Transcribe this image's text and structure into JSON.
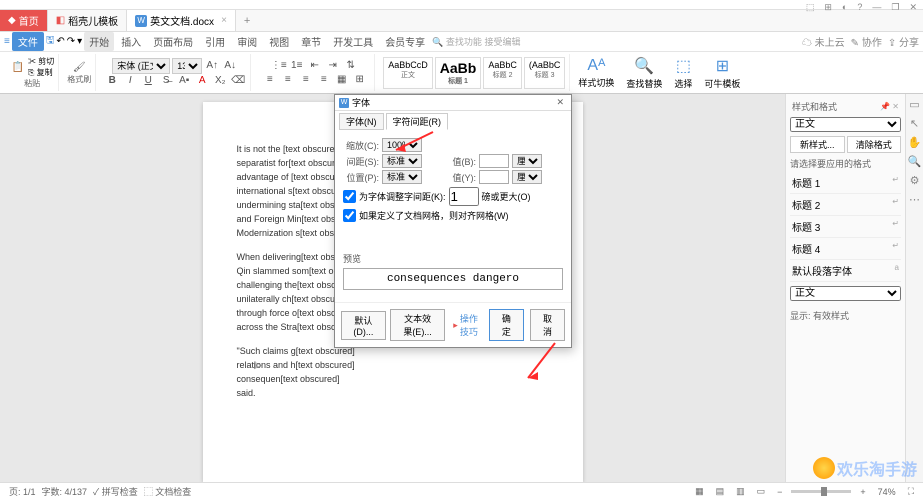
{
  "tabs": {
    "home": "首页",
    "tpl": "稻壳儿模板",
    "doc": "英文文档.docx"
  },
  "win_ctrls": [
    "⬚",
    "⊞",
    "◐",
    "?",
    "—",
    "❐",
    "✕"
  ],
  "menu": {
    "file": "文件",
    "items": [
      "开始",
      "插入",
      "页面布局",
      "引用",
      "审阅",
      "视图",
      "章节",
      "开发工具",
      "会员专享"
    ],
    "search_placeholder": "查找功能",
    "search_tpl": "接受编辑",
    "right": [
      "未上云",
      "协作",
      "分享"
    ]
  },
  "ribbon": {
    "paste": "粘贴",
    "copy": "复制",
    "cut": "剪切",
    "format_painter": "格式刷",
    "font": "宋体 (正文)",
    "size": "13.5",
    "styles": [
      {
        "preview": "AaBbCcD",
        "name": "正文"
      },
      {
        "preview": "AaBb",
        "name": "标题 1"
      },
      {
        "preview": "AaBbC",
        "name": "标题 2"
      },
      {
        "preview": "(AaBbC",
        "name": "标题 3"
      }
    ],
    "style_switch": "样式切换",
    "find_replace": "查找替换",
    "select": "选择",
    "cowork": "可牛模板"
  },
  "document": {
    "p1": "It is not the [text obscured]\nseparatist for[text obscured]\nadvantage of [text obscured]\ninternational s[text obscured]\nundermining sta[text obscured]\nand Foreign Min[text obscured]\nModernization s[text obscured]",
    "p2": "When delivering[text obscured]\nQin slammed som[text obscured]\nchallenging the[text obscured]\nunilaterally ch[text obscured]\nthrough force o[text obscured]\nacross the Stra[text obscured]",
    "p3": "\"Such claims g[text obscured]\nrelations and h[text obscured]\nconsequen[text obscured]\nsaid."
  },
  "dialog": {
    "title": "字体",
    "tabs": [
      "字体(N)",
      "字符间距(R)"
    ],
    "scale_label": "缩放(C):",
    "scale_val": "100%",
    "spacing_label": "间距(S):",
    "spacing_val": "标准",
    "spacing_by": "值(B):",
    "unit": "厘米",
    "position_label": "位置(P):",
    "position_val": "标准",
    "position_by": "值(Y):",
    "kerning": "为字体调整字间距(K):",
    "kerning_val": "1",
    "kerning_unit": "磅或更大(O)",
    "snap": "如果定义了文档网格，则对齐网格(W)",
    "preview_label": "预览",
    "preview_text": "consequences dangero",
    "default_btn": "默认(D)...",
    "text_effect": "文本效果(E)...",
    "op_tips": "操作技巧",
    "ok": "确定",
    "cancel": "取消"
  },
  "styles_pane": {
    "title": "样式和格式",
    "current": "正文",
    "new_style": "新样式...",
    "clear": "清除格式",
    "choose": "请选择要应用的格式",
    "list": [
      "标题 1",
      "标题 2",
      "标题 3",
      "标题 4"
    ],
    "default_para": "默认段落字体",
    "body": "正文",
    "show": "显示: 有效样式"
  },
  "statusbar": {
    "page": "页: 1/1",
    "words": "字数: 4/137",
    "spell": "拼写检查",
    "doc_check": "文档检查",
    "zoom": "74%"
  },
  "watermark": "欢乐淘手游"
}
